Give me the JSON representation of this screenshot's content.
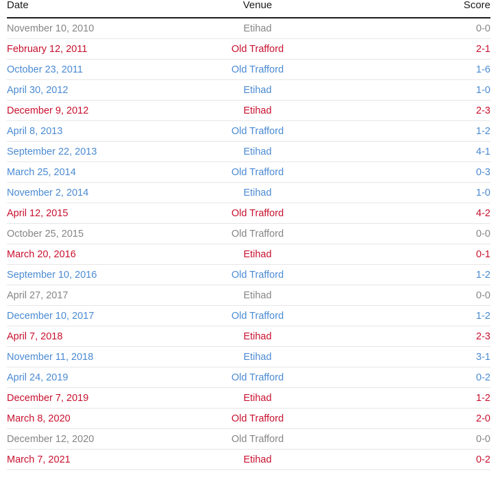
{
  "columns": {
    "date": "Date",
    "venue": "Venue",
    "score": "Score"
  },
  "colors": {
    "draw": "#858585",
    "united_win": "#c8102e",
    "city_win": "#4a8ad2"
  },
  "rows": [
    {
      "date": "November 10, 2010",
      "venue": "Etihad",
      "score": "0-0",
      "result": "draw"
    },
    {
      "date": "February 12, 2011",
      "venue": "Old Trafford",
      "score": "2-1",
      "result": "united_win"
    },
    {
      "date": "October 23, 2011",
      "venue": "Old Trafford",
      "score": "1-6",
      "result": "city_win"
    },
    {
      "date": "April 30, 2012",
      "venue": "Etihad",
      "score": "1-0",
      "result": "city_win"
    },
    {
      "date": "December 9, 2012",
      "venue": "Etihad",
      "score": "2-3",
      "result": "united_win"
    },
    {
      "date": "April 8, 2013",
      "venue": "Old Trafford",
      "score": "1-2",
      "result": "city_win"
    },
    {
      "date": "September 22, 2013",
      "venue": "Etihad",
      "score": "4-1",
      "result": "city_win"
    },
    {
      "date": "March 25, 2014",
      "venue": "Old Trafford",
      "score": "0-3",
      "result": "city_win"
    },
    {
      "date": "November 2, 2014",
      "venue": "Etihad",
      "score": "1-0",
      "result": "city_win"
    },
    {
      "date": "April 12, 2015",
      "venue": "Old Trafford",
      "score": "4-2",
      "result": "united_win"
    },
    {
      "date": "October 25, 2015",
      "venue": "Old Trafford",
      "score": "0-0",
      "result": "draw"
    },
    {
      "date": "March 20, 2016",
      "venue": "Etihad",
      "score": "0-1",
      "result": "united_win"
    },
    {
      "date": "September 10, 2016",
      "venue": "Old Trafford",
      "score": "1-2",
      "result": "city_win"
    },
    {
      "date": "April 27, 2017",
      "venue": "Etihad",
      "score": "0-0",
      "result": "draw"
    },
    {
      "date": "December 10, 2017",
      "venue": "Old Trafford",
      "score": "1-2",
      "result": "city_win"
    },
    {
      "date": "April 7, 2018",
      "venue": "Etihad",
      "score": "2-3",
      "result": "united_win"
    },
    {
      "date": "November 11, 2018",
      "venue": "Etihad",
      "score": "3-1",
      "result": "city_win"
    },
    {
      "date": "April 24, 2019",
      "venue": "Old Trafford",
      "score": "0-2",
      "result": "city_win"
    },
    {
      "date": "December 7, 2019",
      "venue": "Etihad",
      "score": "1-2",
      "result": "united_win"
    },
    {
      "date": "March 8, 2020",
      "venue": "Old Trafford",
      "score": "2-0",
      "result": "united_win"
    },
    {
      "date": "December 12, 2020",
      "venue": "Old Trafford",
      "score": "0-0",
      "result": "draw"
    },
    {
      "date": "March 7, 2021",
      "venue": "Etihad",
      "score": "0-2",
      "result": "united_win"
    }
  ]
}
